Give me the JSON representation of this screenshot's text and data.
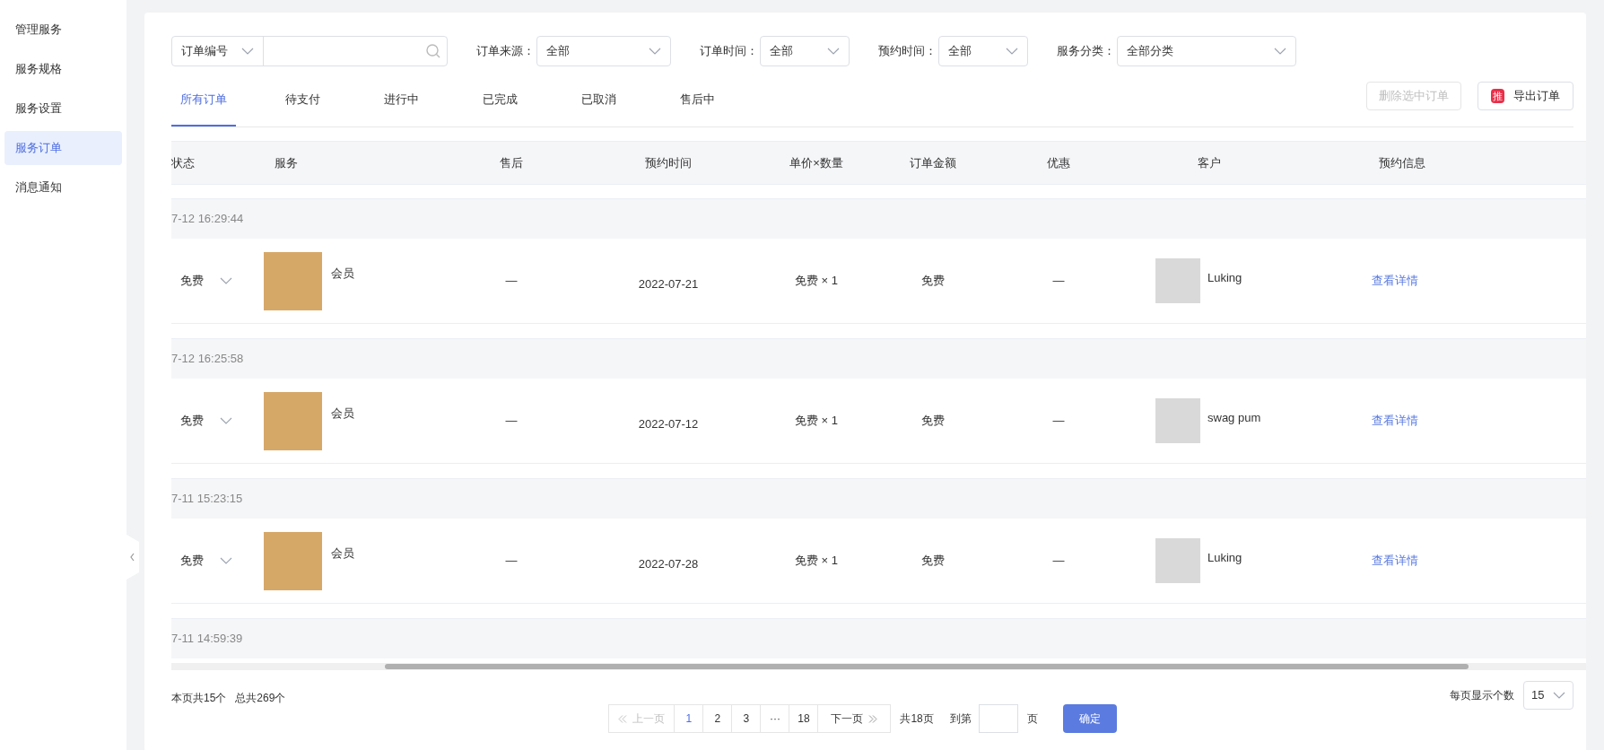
{
  "sidebar": {
    "items": [
      {
        "label": "管理服务",
        "selected": false
      },
      {
        "label": "服务规格",
        "selected": false
      },
      {
        "label": "服务设置",
        "selected": false
      },
      {
        "label": "服务订单",
        "selected": true
      },
      {
        "label": "消息通知",
        "selected": false
      }
    ]
  },
  "search": {
    "type_value": "订单编号"
  },
  "filters": [
    {
      "label": "订单来源：",
      "value": "全部"
    },
    {
      "label": "订单时间：",
      "value": "全部"
    },
    {
      "label": "预约时间：",
      "value": "全部"
    },
    {
      "label": "服务分类：",
      "value": "全部分类"
    }
  ],
  "tabs": [
    {
      "label": "所有订单",
      "selected": true
    },
    {
      "label": "待支付",
      "selected": false
    },
    {
      "label": "进行中",
      "selected": false
    },
    {
      "label": "已完成",
      "selected": false
    },
    {
      "label": "已取消",
      "selected": false
    },
    {
      "label": "售后中",
      "selected": false
    }
  ],
  "actions": {
    "delete_selected": {
      "label": "删除选中订单",
      "disabled": true
    },
    "export": {
      "badge": "推",
      "label": "导出订单"
    }
  },
  "table": {
    "columns": [
      "状态",
      "服务",
      "售后",
      "预约时间",
      "单价×数量",
      "订单金额",
      "优惠",
      "客户",
      "预约信息"
    ],
    "groups": [
      {
        "time": "7-12 16:29:44",
        "rows": [
          {
            "status": "免费",
            "service": "会员",
            "after_sale": "—",
            "appointment": "2022-07-21",
            "price_qty": "免费 × 1",
            "amount": "免费",
            "discount": "—",
            "customer": "Luking",
            "details": "查看详情"
          }
        ]
      },
      {
        "time": "7-12 16:25:58",
        "rows": [
          {
            "status": "免费",
            "service": "会员",
            "after_sale": "—",
            "appointment": "2022-07-12",
            "price_qty": "免费 × 1",
            "amount": "免费",
            "discount": "—",
            "customer": "swag pum",
            "details": "查看详情"
          }
        ]
      },
      {
        "time": "7-11 15:23:15",
        "rows": [
          {
            "status": "免费",
            "service": "会员",
            "after_sale": "—",
            "appointment": "2022-07-28",
            "price_qty": "免费 × 1",
            "amount": "免费",
            "discount": "—",
            "customer": "Luking",
            "details": "查看详情"
          }
        ]
      },
      {
        "time": "7-11 14:59:39"
      }
    ]
  },
  "pagination": {
    "page_count_text": "本页共15个",
    "total_text": "总共269个",
    "prev": {
      "label": "上一页",
      "disabled": true
    },
    "pages": [
      {
        "label": "1",
        "selected": true
      },
      {
        "label": "2",
        "selected": false
      },
      {
        "label": "3",
        "selected": false
      },
      {
        "label": "···",
        "selected": false
      },
      {
        "label": "18",
        "selected": false
      }
    ],
    "next": {
      "label": "下一页",
      "disabled": false
    },
    "total_pages": "共18页",
    "goto_label": "到第",
    "goto_suffix": "页",
    "confirm": "确定",
    "per_page_label": "每页显示个数",
    "per_page": "15"
  }
}
